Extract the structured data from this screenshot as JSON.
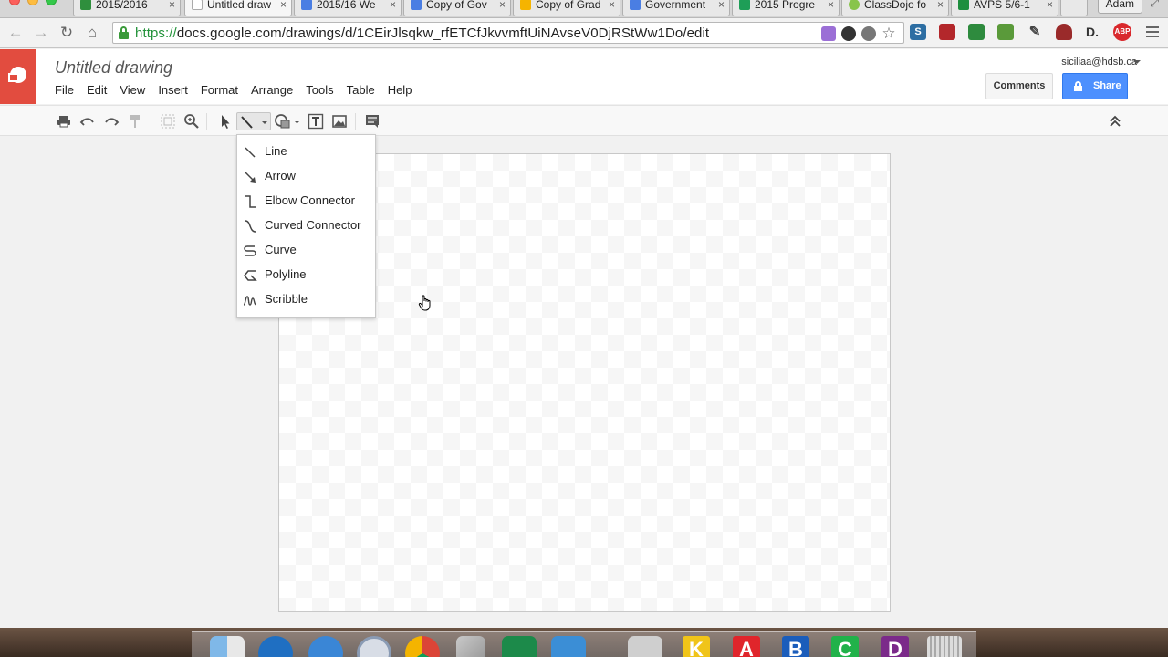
{
  "browser": {
    "tabs": [
      {
        "label": "2015/2016",
        "icon": "drive-icon",
        "color": "#2f8f3d"
      },
      {
        "label": "Untitled draw",
        "icon": "page-icon",
        "color": "#cccccc"
      },
      {
        "label": "2015/16 We",
        "icon": "docs-icon",
        "color": "#4a7ee3"
      },
      {
        "label": "Copy of Gov",
        "icon": "docs-icon",
        "color": "#4a7ee3"
      },
      {
        "label": "Copy of Grad",
        "icon": "slides-icon",
        "color": "#f5b400"
      },
      {
        "label": "Government",
        "icon": "docs-icon",
        "color": "#4a7ee3"
      },
      {
        "label": "2015 Progre",
        "icon": "sheets-icon",
        "color": "#1e9e57"
      },
      {
        "label": "ClassDojo fo",
        "icon": "classdojo-icon",
        "color": "#88c44a"
      },
      {
        "label": "AVPS 5/6-1",
        "icon": "classroom-icon",
        "color": "#1e8e3e"
      }
    ],
    "user_chip": "Adam",
    "url_scheme": "https://",
    "url_rest": "docs.google.com/drawings/d/1CEirJlsqkw_rfETCfJkvvmftUiNAvseV0DjRStWw1Do/edit",
    "extensions": [
      {
        "name": "s-extension-icon",
        "label": "S",
        "color": "#2d6ea3"
      },
      {
        "name": "film-extension-icon",
        "label": "",
        "color": "#b3272b"
      },
      {
        "name": "classroom-extension-icon",
        "label": "",
        "color": "#2e8b3e"
      },
      {
        "name": "evernote-extension-icon",
        "label": "",
        "color": "#5a9a3a"
      },
      {
        "name": "pen-extension-icon",
        "label": "",
        "color": "#444444"
      },
      {
        "name": "chair-extension-icon",
        "label": "",
        "color": "#9a2a2a"
      },
      {
        "name": "d-extension-icon",
        "label": "D.",
        "color": "#333333"
      },
      {
        "name": "adblock-icon",
        "label": "ABP",
        "color": "#d9282c"
      }
    ]
  },
  "docs": {
    "title": "Untitled drawing",
    "menu": [
      "File",
      "Edit",
      "View",
      "Insert",
      "Format",
      "Arrange",
      "Tools",
      "Table",
      "Help"
    ],
    "account_email": "siciliaa@hdsb.ca",
    "comments_label": "Comments",
    "share_label": "Share",
    "accent_color": "#4d90fe",
    "logo_color": "#e24c3f"
  },
  "line_menu": {
    "items": [
      {
        "label": "Line",
        "icon": "line-icon"
      },
      {
        "label": "Arrow",
        "icon": "arrow-icon"
      },
      {
        "label": "Elbow Connector",
        "icon": "elbow-connector-icon"
      },
      {
        "label": "Curved Connector",
        "icon": "curved-connector-icon"
      },
      {
        "label": "Curve",
        "icon": "curve-icon"
      },
      {
        "label": "Polyline",
        "icon": "polyline-icon"
      },
      {
        "label": "Scribble",
        "icon": "scribble-icon"
      }
    ]
  },
  "dock": {
    "letters": [
      {
        "label": "K",
        "color": "#f0c419"
      },
      {
        "label": "A",
        "color": "#e0252b"
      },
      {
        "label": "B",
        "color": "#1b5dbb"
      },
      {
        "label": "C",
        "color": "#21b24a"
      },
      {
        "label": "D",
        "color": "#7b2a8a"
      }
    ]
  }
}
